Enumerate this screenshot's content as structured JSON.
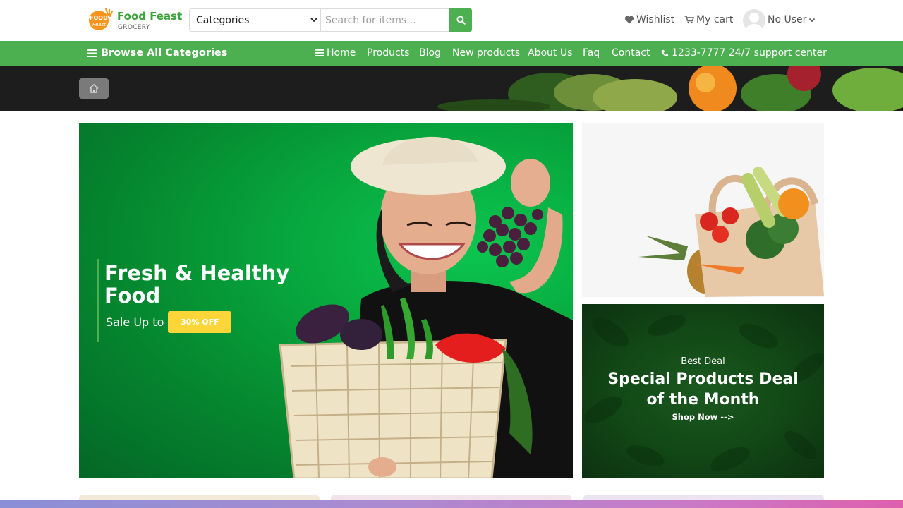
{
  "brand": {
    "name": "Food Feast",
    "subtitle": "GROCERY",
    "mark_line1": "FOOD",
    "mark_line2": "Feast"
  },
  "search": {
    "category_value": "Categories",
    "placeholder": "Search for items..."
  },
  "header_links": {
    "wishlist": "Wishlist",
    "cart": "My cart",
    "user": "No User"
  },
  "nav": {
    "browse": "Browse All Categories",
    "items": [
      "Home",
      "Products",
      "Blog",
      "New products",
      "About Us",
      "Faq",
      "Contact"
    ],
    "support": "1233-7777 24/7 support center"
  },
  "hero": {
    "title": "Fresh & Healthy Food",
    "sale_text": "Sale Up to",
    "badge": "30% OFF"
  },
  "deal": {
    "kicker": "Best Deal",
    "title_line1": "Special Products Deal",
    "title_line2": "of the Month",
    "cta": "Shop Now -->"
  },
  "colors": {
    "accent": "#4caf50",
    "badge": "#fcd538",
    "deal_bg": "#124616"
  }
}
